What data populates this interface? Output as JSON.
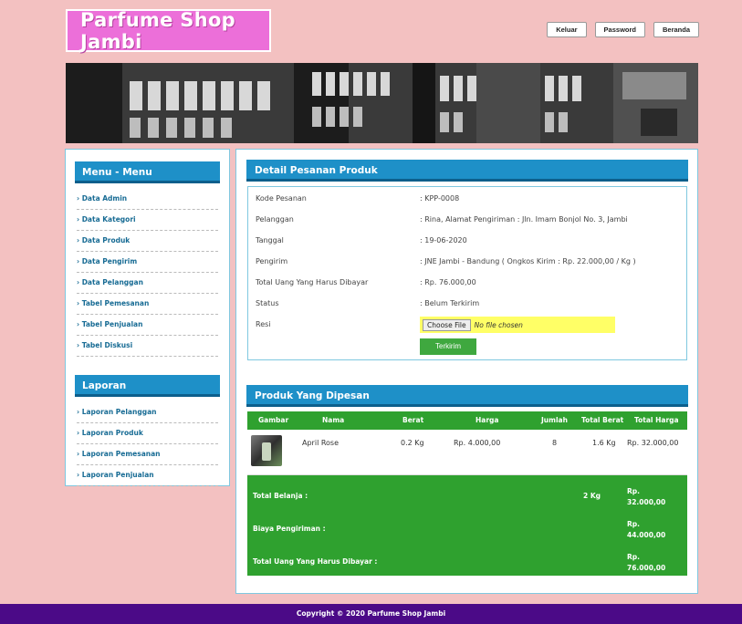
{
  "header": {
    "site_title": "Parfume Shop Jambi",
    "nav": [
      "Keluar",
      "Password",
      "Beranda"
    ]
  },
  "sidebar": {
    "menu_title": "Menu - Menu",
    "menu_items": [
      "Data Admin",
      "Data Kategori",
      "Data Produk",
      "Data Pengirim",
      "Data Pelanggan",
      "Tabel Pemesanan",
      "Tabel Penjualan",
      "Tabel Diskusi"
    ],
    "report_title": "Laporan",
    "report_items": [
      "Laporan Pelanggan",
      "Laporan Produk",
      "Laporan Pemesanan",
      "Laporan Penjualan"
    ]
  },
  "detail": {
    "title": "Detail Pesanan Produk",
    "rows": [
      {
        "label": "Kode Pesanan",
        "value": ": KPP-0008"
      },
      {
        "label": "Pelanggan",
        "value": ": Rina, Alamat Pengiriman : Jln. Imam Bonjol No. 3, Jambi"
      },
      {
        "label": "Tanggal",
        "value": ": 19-06-2020"
      },
      {
        "label": "Pengirim",
        "value": ": JNE Jambi - Bandung ( Ongkos Kirim : Rp. 22.000,00 / Kg )"
      },
      {
        "label": "Total Uang Yang Harus Dibayar",
        "value": ": Rp. 76.000,00"
      },
      {
        "label": "Status",
        "value": ": Belum Terkirim"
      }
    ],
    "resi_label": "Resi",
    "file_button": "Choose File",
    "file_status": "No file chosen",
    "submit_label": "Terkirim"
  },
  "products": {
    "title": "Produk Yang Dipesan",
    "headers": [
      "Gambar",
      "Nama",
      "Berat",
      "Harga",
      "Jumlah",
      "Total Berat",
      "Total Harga"
    ],
    "rows": [
      {
        "name": "April Rose",
        "weight": "0.2 Kg",
        "price": "Rp. 4.000,00",
        "qty": "8",
        "total_weight": "1.6 Kg",
        "total_price": "Rp. 32.000,00"
      }
    ],
    "totals": {
      "belanja_label": "Total Belanja :",
      "belanja_weight": "2 Kg",
      "belanja_value": "Rp. 32.000,00",
      "biaya_label": "Biaya Pengiriman :",
      "biaya_value": "Rp. 44.000,00",
      "total_label": "Total Uang Yang Harus Dibayar :",
      "total_value": "Rp. 76.000,00"
    }
  },
  "footer": {
    "text": "Copyright © 2020 Parfume Shop Jambi"
  },
  "colors": {
    "page_bg": "#f3c1c1",
    "logo_bg": "#ec6fd9",
    "title_bar": "#1e90c8",
    "table_green": "#2fa12f",
    "footer_bg": "#4b0a87",
    "file_highlight": "#ffff66"
  }
}
